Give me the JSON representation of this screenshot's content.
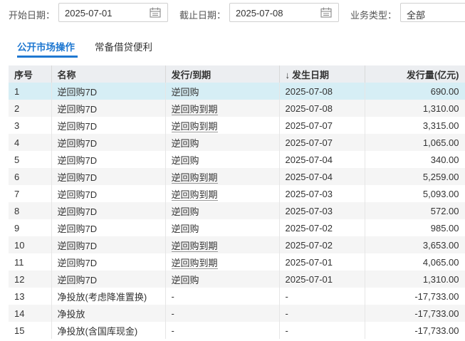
{
  "filters": {
    "start_label": "开始日期：",
    "start_value": "2025-07-01",
    "end_label": "截止日期：",
    "end_value": "2025-07-08",
    "type_label": "业务类型：",
    "type_value": "全部"
  },
  "tabs": [
    {
      "label": "公开市场操作",
      "active": true
    },
    {
      "label": "常备借贷便利",
      "active": false
    }
  ],
  "table": {
    "headers": {
      "index": "序号",
      "name": "名称",
      "kind": "发行/到期",
      "date": "发生日期",
      "date_sort_arrow": "↓",
      "amount": "发行量(亿元)"
    },
    "rows": [
      {
        "index": "1",
        "name": "逆回购7D",
        "kind": "逆回购",
        "date": "2025-07-08",
        "amount": "690.00"
      },
      {
        "index": "2",
        "name": "逆回购7D",
        "kind": "逆回购到期",
        "date": "2025-07-08",
        "amount": "1,310.00"
      },
      {
        "index": "3",
        "name": "逆回购7D",
        "kind": "逆回购到期",
        "date": "2025-07-07",
        "amount": "3,315.00"
      },
      {
        "index": "4",
        "name": "逆回购7D",
        "kind": "逆回购",
        "date": "2025-07-07",
        "amount": "1,065.00"
      },
      {
        "index": "5",
        "name": "逆回购7D",
        "kind": "逆回购",
        "date": "2025-07-04",
        "amount": "340.00"
      },
      {
        "index": "6",
        "name": "逆回购7D",
        "kind": "逆回购到期",
        "date": "2025-07-04",
        "amount": "5,259.00"
      },
      {
        "index": "7",
        "name": "逆回购7D",
        "kind": "逆回购到期",
        "date": "2025-07-03",
        "amount": "5,093.00"
      },
      {
        "index": "8",
        "name": "逆回购7D",
        "kind": "逆回购",
        "date": "2025-07-03",
        "amount": "572.00"
      },
      {
        "index": "9",
        "name": "逆回购7D",
        "kind": "逆回购",
        "date": "2025-07-02",
        "amount": "985.00"
      },
      {
        "index": "10",
        "name": "逆回购7D",
        "kind": "逆回购到期",
        "date": "2025-07-02",
        "amount": "3,653.00"
      },
      {
        "index": "11",
        "name": "逆回购7D",
        "kind": "逆回购到期",
        "date": "2025-07-01",
        "amount": "4,065.00"
      },
      {
        "index": "12",
        "name": "逆回购7D",
        "kind": "逆回购",
        "date": "2025-07-01",
        "amount": "1,310.00"
      },
      {
        "index": "13",
        "name": "净投放(考虑降准置换)",
        "kind": "-",
        "date": "-",
        "amount": "-17,733.00"
      },
      {
        "index": "14",
        "name": "净投放",
        "kind": "-",
        "date": "-",
        "amount": "-17,733.00"
      },
      {
        "index": "15",
        "name": "净投放(含国库现金)",
        "kind": "-",
        "date": "-",
        "amount": "-17,733.00"
      }
    ]
  },
  "colors": {
    "accent": "#1f78d1",
    "selected_row": "#d6eef5",
    "header_bg": "#eceef1"
  }
}
